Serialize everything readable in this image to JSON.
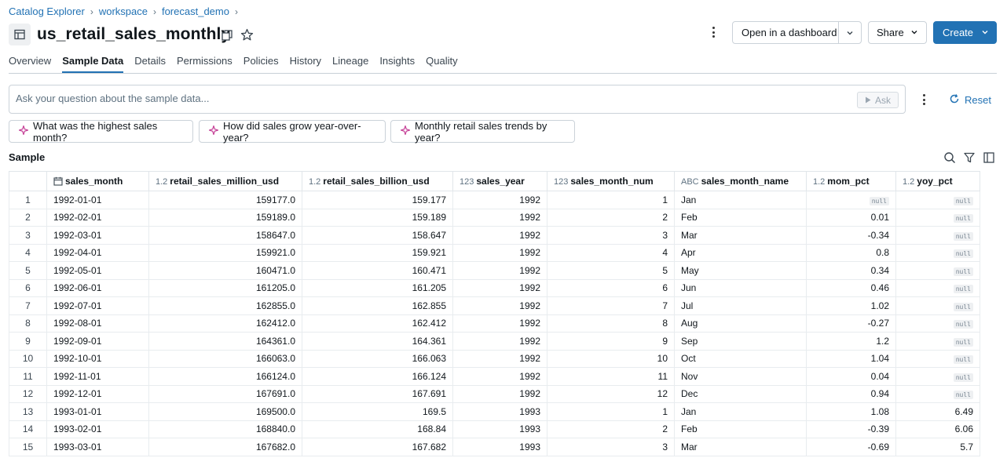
{
  "breadcrumb": [
    "Catalog Explorer",
    "workspace",
    "forecast_demo"
  ],
  "title": "us_retail_sales_monthly",
  "actions": {
    "dashboard_label": "Open in a dashboard",
    "share_label": "Share",
    "create_label": "Create"
  },
  "tabs": [
    "Overview",
    "Sample Data",
    "Details",
    "Permissions",
    "Policies",
    "History",
    "Lineage",
    "Insights",
    "Quality"
  ],
  "active_tab": "Sample Data",
  "ask": {
    "placeholder": "Ask your question about the sample data...",
    "button_label": "Ask",
    "reset_label": "Reset"
  },
  "suggestions": [
    "What was the highest sales month?",
    "How did sales grow year-over-year?",
    "Monthly retail sales trends by year?"
  ],
  "sample_label": "Sample",
  "table": {
    "columns": [
      {
        "type": "",
        "name": ""
      },
      {
        "type": "date-icon",
        "name": "sales_month"
      },
      {
        "type": "1.2",
        "name": "retail_sales_million_usd"
      },
      {
        "type": "1.2",
        "name": "retail_sales_billion_usd"
      },
      {
        "type": "123",
        "name": "sales_year"
      },
      {
        "type": "123",
        "name": "sales_month_num"
      },
      {
        "type": "ABC",
        "name": "sales_month_name"
      },
      {
        "type": "1.2",
        "name": "mom_pct"
      },
      {
        "type": "1.2",
        "name": "yoy_pct"
      }
    ],
    "rows": [
      [
        "1",
        "1992-01-01",
        "159177.0",
        "159.177",
        "1992",
        "1",
        "Jan",
        "null",
        "null"
      ],
      [
        "2",
        "1992-02-01",
        "159189.0",
        "159.189",
        "1992",
        "2",
        "Feb",
        "0.01",
        "null"
      ],
      [
        "3",
        "1992-03-01",
        "158647.0",
        "158.647",
        "1992",
        "3",
        "Mar",
        "-0.34",
        "null"
      ],
      [
        "4",
        "1992-04-01",
        "159921.0",
        "159.921",
        "1992",
        "4",
        "Apr",
        "0.8",
        "null"
      ],
      [
        "5",
        "1992-05-01",
        "160471.0",
        "160.471",
        "1992",
        "5",
        "May",
        "0.34",
        "null"
      ],
      [
        "6",
        "1992-06-01",
        "161205.0",
        "161.205",
        "1992",
        "6",
        "Jun",
        "0.46",
        "null"
      ],
      [
        "7",
        "1992-07-01",
        "162855.0",
        "162.855",
        "1992",
        "7",
        "Jul",
        "1.02",
        "null"
      ],
      [
        "8",
        "1992-08-01",
        "162412.0",
        "162.412",
        "1992",
        "8",
        "Aug",
        "-0.27",
        "null"
      ],
      [
        "9",
        "1992-09-01",
        "164361.0",
        "164.361",
        "1992",
        "9",
        "Sep",
        "1.2",
        "null"
      ],
      [
        "10",
        "1992-10-01",
        "166063.0",
        "166.063",
        "1992",
        "10",
        "Oct",
        "1.04",
        "null"
      ],
      [
        "11",
        "1992-11-01",
        "166124.0",
        "166.124",
        "1992",
        "11",
        "Nov",
        "0.04",
        "null"
      ],
      [
        "12",
        "1992-12-01",
        "167691.0",
        "167.691",
        "1992",
        "12",
        "Dec",
        "0.94",
        "null"
      ],
      [
        "13",
        "1993-01-01",
        "169500.0",
        "169.5",
        "1993",
        "1",
        "Jan",
        "1.08",
        "6.49"
      ],
      [
        "14",
        "1993-02-01",
        "168840.0",
        "168.84",
        "1993",
        "2",
        "Feb",
        "-0.39",
        "6.06"
      ],
      [
        "15",
        "1993-03-01",
        "167682.0",
        "167.682",
        "1993",
        "3",
        "Mar",
        "-0.69",
        "5.7"
      ]
    ]
  },
  "colors": {
    "accent": "#2272b4",
    "sparkle": "#c53f96"
  }
}
